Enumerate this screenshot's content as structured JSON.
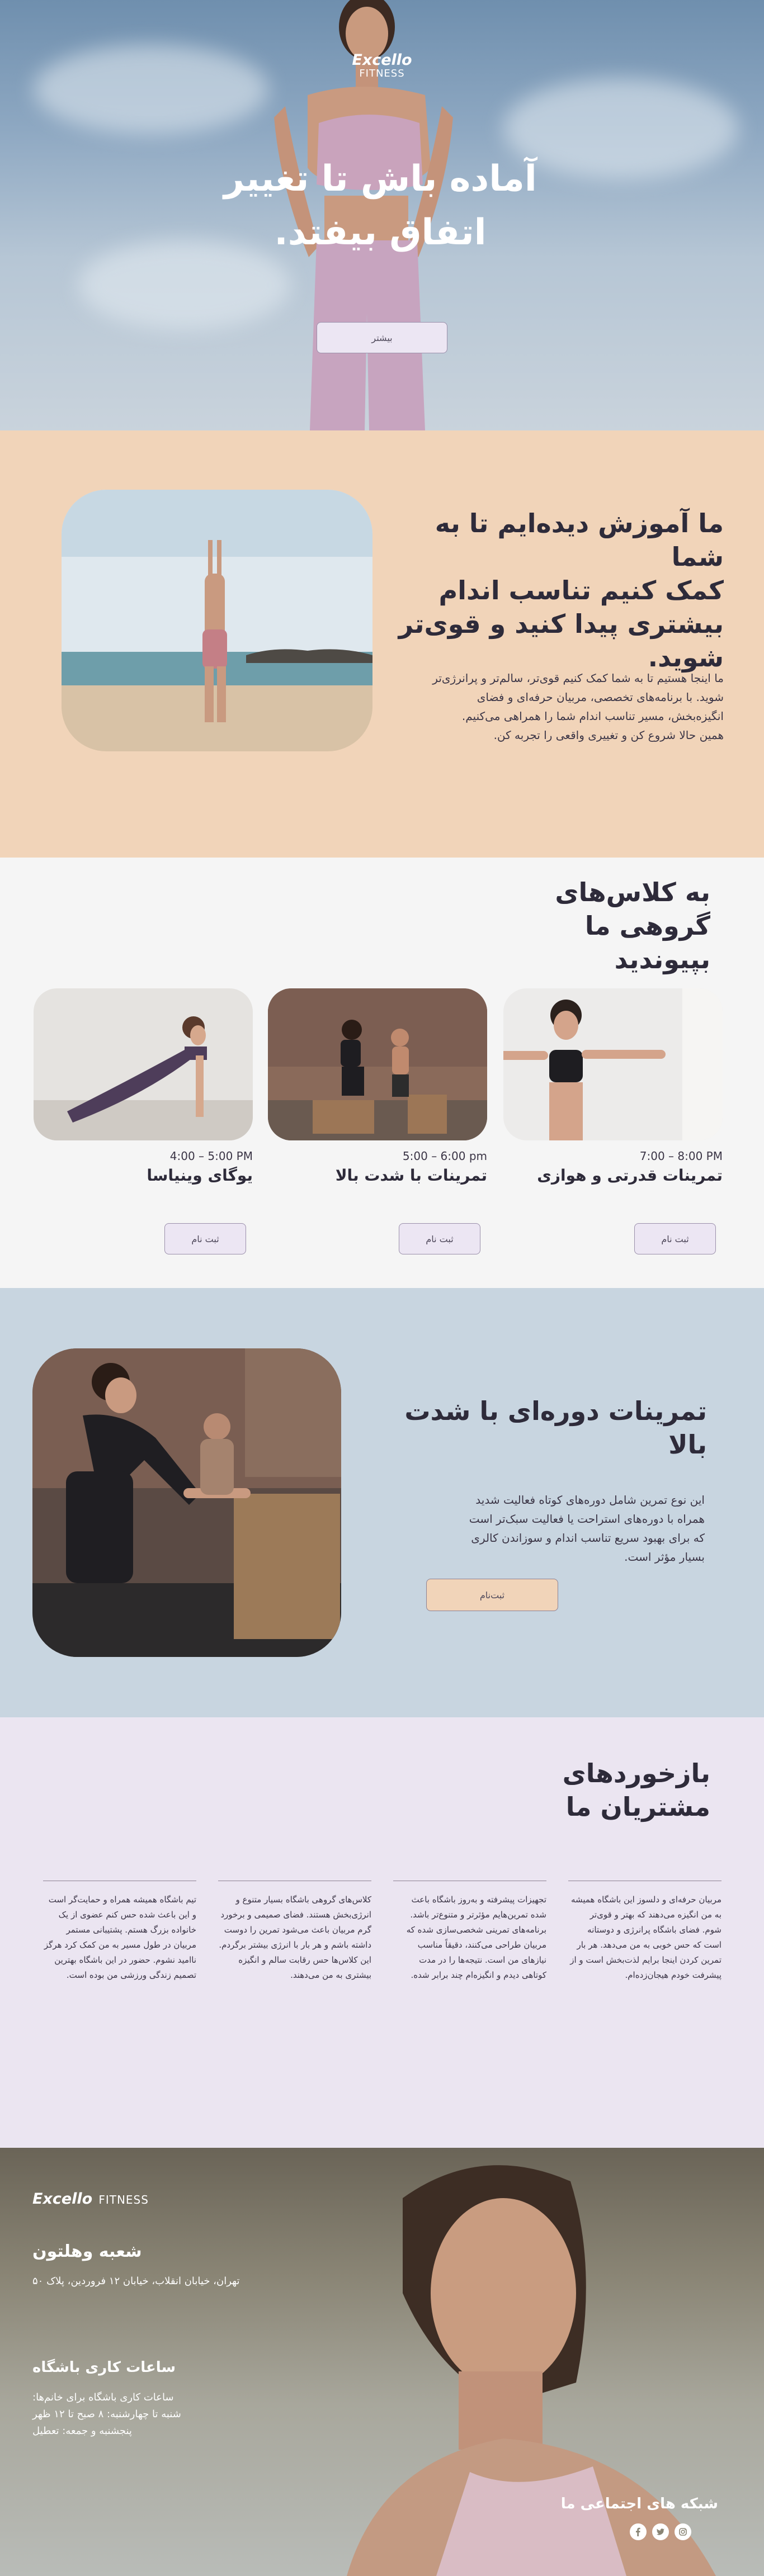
{
  "hero": {
    "brand": "Excello",
    "brand_sub": "FITNESS",
    "headline_line1": "آماده باش تا تغییر",
    "headline_line2": "اتفاق بیفتد.",
    "more_button": "بیشتر"
  },
  "about": {
    "title_line1": "ما آموزش دیده‌ایم تا به شما",
    "title_line2": "کمک کنیم تناسب اندام",
    "title_line3": "بیشتری پیدا کنید و قوی‌تر",
    "title_line4": "شوید.",
    "text_line1": "ما اینجا هستیم تا به شما کمک کنیم قوی‌تر، سالم‌تر و پرانرژی‌تر",
    "text_line2": "شوید. با برنامه‌های تخصصی، مربیان حرفه‌ای و فضای",
    "text_line3": "انگیزه‌بخش، مسیر تناسب اندام شما را همراهی می‌کنیم.",
    "text_line4": "همین حالا شروع کن و تغییری واقعی را تجربه کن."
  },
  "classes": {
    "title_line1": "به کلاس‌های",
    "title_line2": "گروهی ما",
    "title_line3": "بپیوندید",
    "items": [
      {
        "time": "7:00 – 8:00 PM",
        "name": "تمرینات قدرتی و هوازی",
        "button": "ثبت نام"
      },
      {
        "time": "5:00 – 6:00 pm",
        "name": "تمرینات با شدت بالا",
        "button": "ثبت نام"
      },
      {
        "time": "4:00 – 5:00 PM",
        "name": "یوگای وینیاسا",
        "button": "ثبت نام"
      }
    ]
  },
  "hiit": {
    "title": "تمرینات دوره‌ای با شدت بالا",
    "text_line1": "این نوع تمرین شامل دوره‌های کوتاه فعالیت شدید",
    "text_line2": "همراه با دوره‌های استراحت یا فعالیت سبک‌تر است",
    "text_line3": "که برای بهبود سریع تناسب اندام و سوزاندن کالری",
    "text_line4": "بسیار مؤثر است.",
    "button": "ثبت‌نام"
  },
  "testimonials": {
    "title_line1": "بازخوردهای",
    "title_line2": "مشتریان ما",
    "quotes": [
      "مربیان حرفه‌ای و دلسوز این باشگاه همیشه به من انگیزه می‌دهند که بهتر و قوی‌تر شوم. فضای باشگاه پرانرژی و دوستانه است که حس خوبی به من می‌دهد. هر بار تمرین کردن اینجا برایم لذت‌بخش است و از پیشرفت خودم هیجان‌زده‌ام.",
      "تجهیزات پیشرفته و به‌روز باشگاه باعث شده تمرین‌هایم مؤثرتر و متنوع‌تر باشد. برنامه‌های تمرینی شخصی‌سازی شده که مربیان طراحی می‌کنند، دقیقاً مناسب نیازهای من است. نتیجه‌ها را در مدت کوتاهی دیدم و انگیزه‌ام چند برابر شده.",
      "کلاس‌های گروهی باشگاه بسیار متنوع و انرژی‌بخش هستند. فضای صمیمی و برخورد گرم مربیان باعث می‌شود تمرین را دوست داشته باشم و هر بار با انرژی بیشتر برگردم. این کلاس‌ها حس رقابت سالم و انگیزه بیشتری به من می‌دهند.",
      "تیم باشگاه همیشه همراه و حمایت‌گر است و این باعث شده حس کنم عضوی از یک خانواده بزرگ هستم. پشتیبانی مستمر مربیان در طول مسیر به من کمک کرد هرگز ناامید نشوم. حضور در این باشگاه بهترین تصمیم زندگی ورزشی من بوده است."
    ]
  },
  "footer": {
    "brand": "Excello",
    "brand_sub": "FITNESS",
    "branch_title": "شعبه وهلتون",
    "branch_address": "تهران، خیابان انقلاب، خیابان ۱۲ فروردین، پلاک ۵۰",
    "hours_title": "ساعات کاری باشگاه",
    "hours_line1": "ساعات کاری باشگاه برای خانم‌ها:",
    "hours_line2": "شنبه تا چهارشنبه: ۸ صبح تا ۱۲ ظهر",
    "hours_line3": "پنجشنبه و جمعه: تعطیل",
    "social_title": "شبکه های اجتماعی ما"
  }
}
